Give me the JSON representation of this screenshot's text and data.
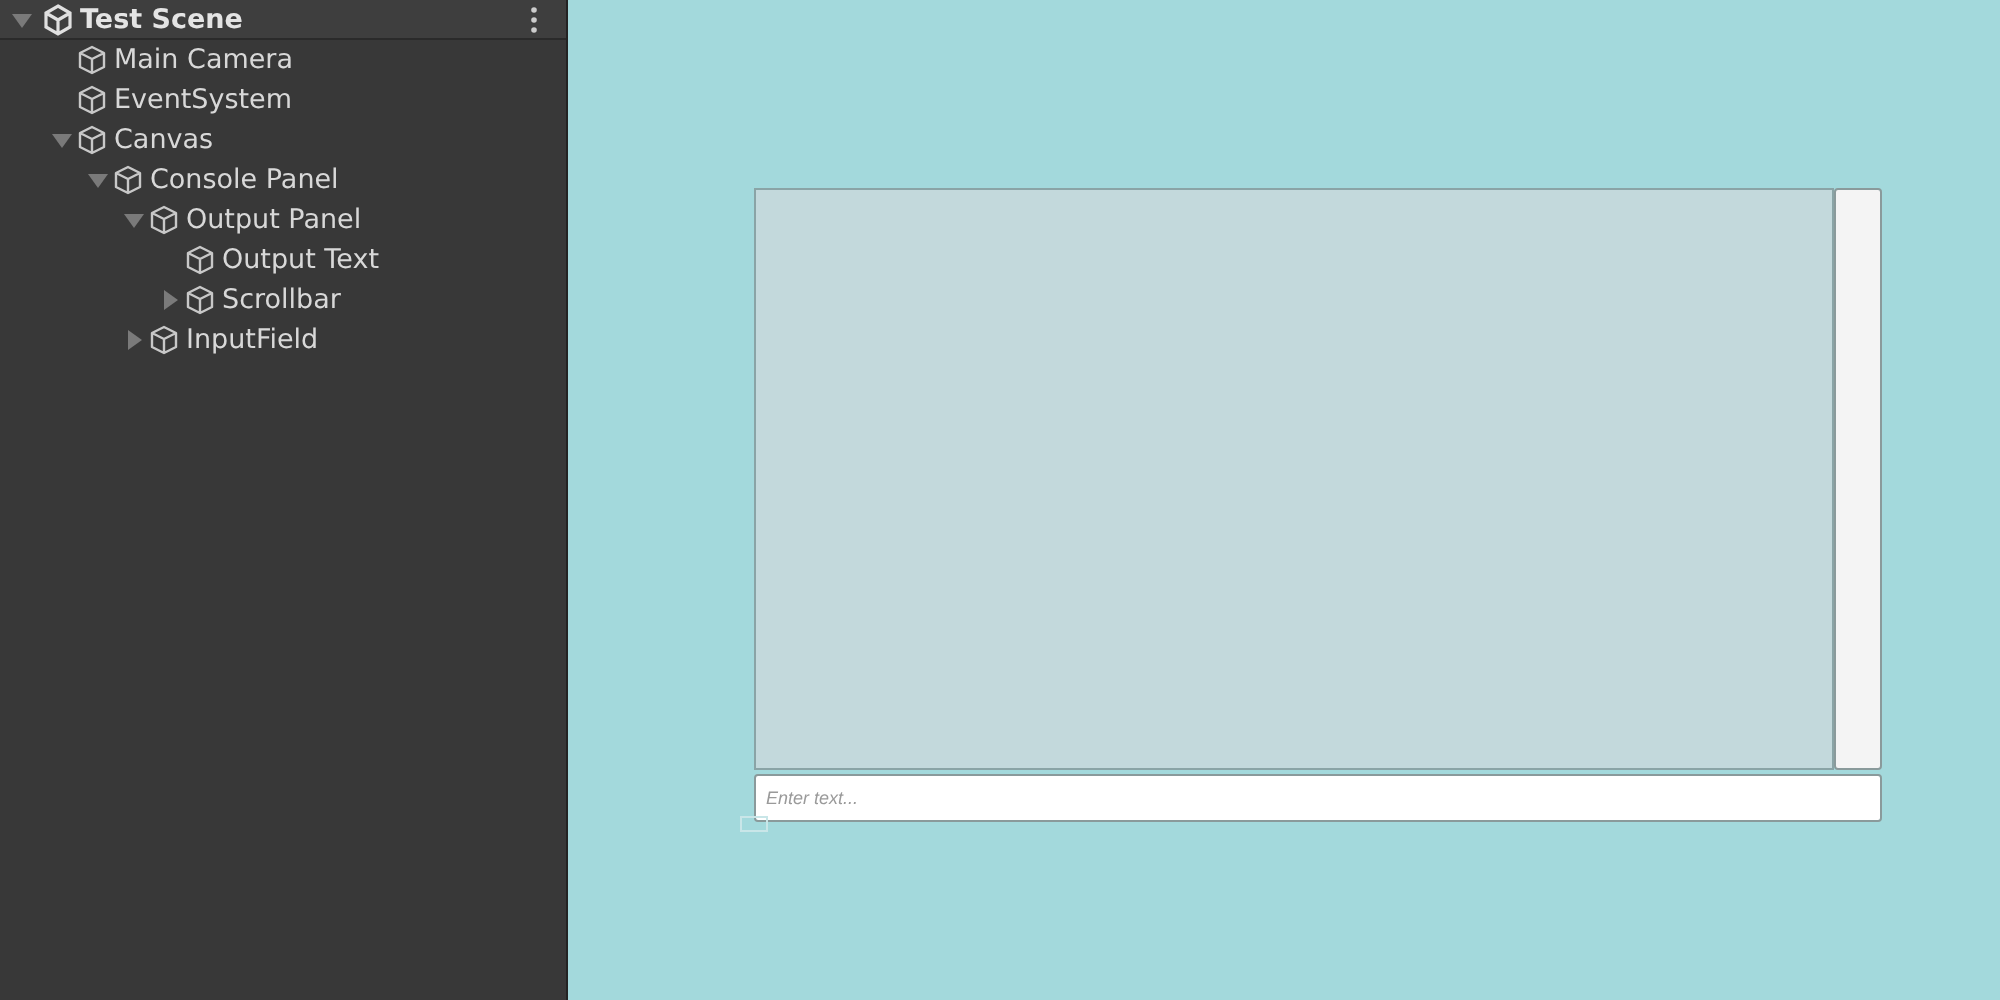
{
  "hierarchy": {
    "scene": {
      "title": "Test Scene",
      "expanded": true,
      "children": [
        {
          "name": "Main Camera"
        },
        {
          "name": "EventSystem"
        },
        {
          "name": "Canvas",
          "expanded": true,
          "children": [
            {
              "name": "Console Panel",
              "expanded": true,
              "children": [
                {
                  "name": "Output Panel",
                  "expanded": true,
                  "children": [
                    {
                      "name": "Output Text"
                    },
                    {
                      "name": "Scrollbar",
                      "expanded": false
                    }
                  ]
                },
                {
                  "name": "InputField",
                  "expanded": false
                }
              ]
            }
          ]
        }
      ]
    }
  },
  "scene_view": {
    "input_field": {
      "placeholder": "Enter text..."
    }
  }
}
